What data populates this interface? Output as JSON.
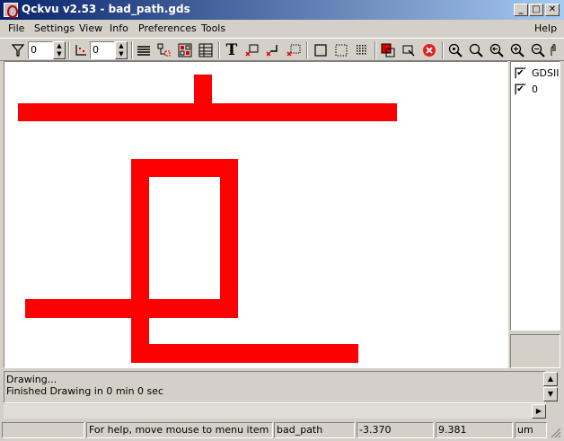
{
  "window": {
    "title": "Qckvu v2.53 - bad_path.gds",
    "minimize_label": "_",
    "maximize_label": "□",
    "close_label": "✕"
  },
  "menu": {
    "file": "File",
    "settings": "Settings",
    "view": "View",
    "info": "Info",
    "preferences": "Preferences",
    "tools": "Tools",
    "help": "Help"
  },
  "toolbar": {
    "filter_value": "0",
    "depth_value": "0",
    "text_icon_glyph": "T"
  },
  "layers": [
    {
      "label": "GDSII",
      "checked": "✔"
    },
    {
      "label": "0",
      "checked": "✔"
    }
  ],
  "log": {
    "line1": "Drawing...",
    "line2": "Finished Drawing in 0 min 0 sec"
  },
  "status": {
    "help_text": "For help, move mouse to menu item or tool",
    "cell_name": "bad_path",
    "x_coord": "-3.370",
    "y_coord": "9.381",
    "units": "um"
  },
  "colors": {
    "geometry": "#ff0000",
    "titlebar_start": "#0a246a",
    "titlebar_end": "#a6caf0"
  }
}
